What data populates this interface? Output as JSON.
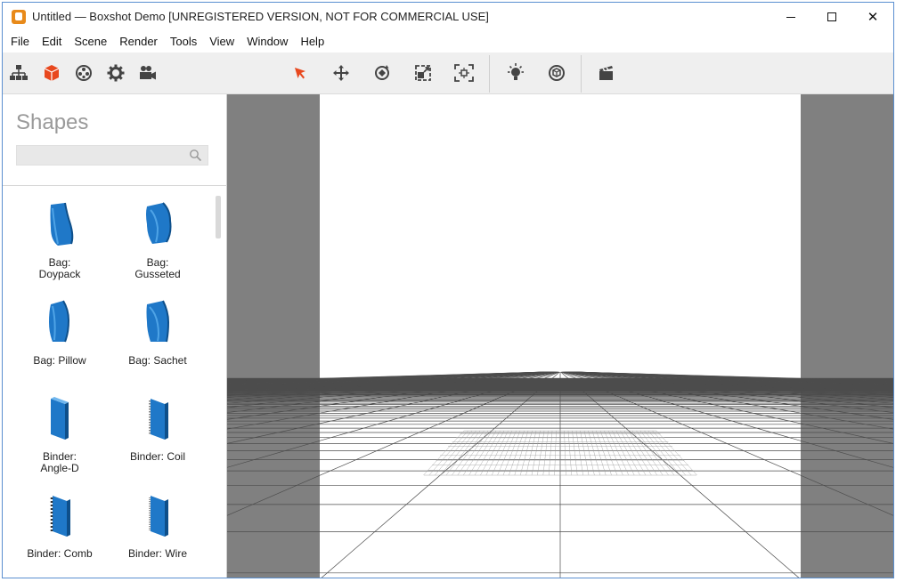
{
  "window": {
    "title": "Untitled — Boxshot Demo [UNREGISTERED VERSION, NOT FOR COMMERCIAL USE]",
    "minimize_icon": "minimize-icon",
    "maximize_icon": "maximize-icon",
    "close_glyph": "✕"
  },
  "menu": [
    "File",
    "Edit",
    "Scene",
    "Render",
    "Tools",
    "View",
    "Window",
    "Help"
  ],
  "toolbar": {
    "left_tools": [
      "scene-tree-icon",
      "shapes-icon",
      "materials-icon",
      "settings-icon",
      "camera-icon"
    ],
    "center_tools": [
      "select-icon",
      "move-icon",
      "rotate-icon",
      "scale-icon",
      "fit-icon"
    ],
    "light_tools": [
      "light-icon",
      "environment-icon"
    ],
    "render_tools": [
      "render-clapper-icon"
    ],
    "active_tool": "shapes-icon",
    "accent_color": "#e8481e"
  },
  "panel": {
    "title": "Shapes",
    "search_placeholder": "",
    "items": [
      {
        "label": "Bag:\nDoypack",
        "icon": "bag-doypack-icon"
      },
      {
        "label": "Bag:\nGusseted",
        "icon": "bag-gusseted-icon"
      },
      {
        "label": "Bag: Pillow",
        "icon": "bag-pillow-icon"
      },
      {
        "label": "Bag: Sachet",
        "icon": "bag-sachet-icon"
      },
      {
        "label": "Binder:\nAngle-D",
        "icon": "binder-angle-d-icon"
      },
      {
        "label": "Binder: Coil",
        "icon": "binder-coil-icon"
      },
      {
        "label": "Binder: Comb",
        "icon": "binder-comb-icon"
      },
      {
        "label": "Binder: Wire",
        "icon": "binder-wire-icon"
      }
    ],
    "item_color": "#1f78c8"
  },
  "viewport": {
    "background": "#808080",
    "canvas": "#ffffff",
    "grid_color": "#555555"
  }
}
